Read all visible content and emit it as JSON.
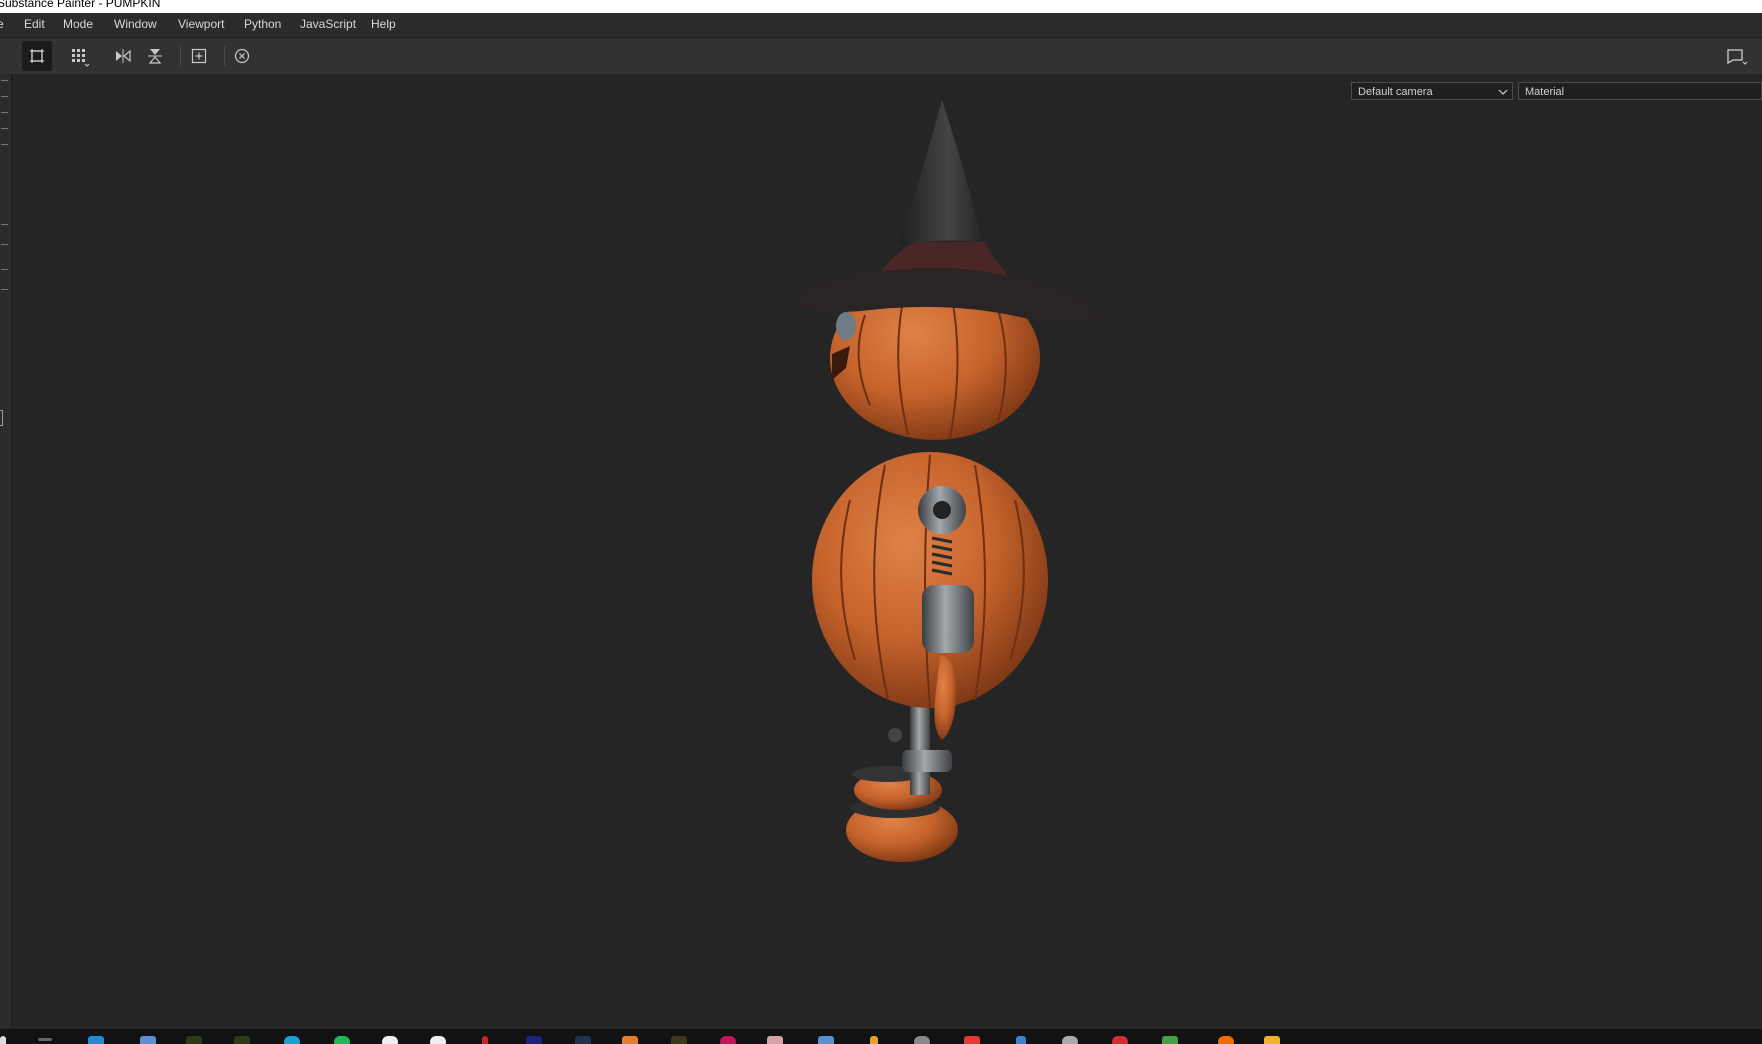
{
  "window": {
    "title": "Substance Painter - PUMPKIN"
  },
  "menubar": {
    "items": [
      {
        "id": "file",
        "label": "e"
      },
      {
        "id": "edit",
        "label": "Edit"
      },
      {
        "id": "mode",
        "label": "Mode"
      },
      {
        "id": "window",
        "label": "Window"
      },
      {
        "id": "viewport",
        "label": "Viewport"
      },
      {
        "id": "python",
        "label": "Python"
      },
      {
        "id": "javascript",
        "label": "JavaScript"
      },
      {
        "id": "help",
        "label": "Help"
      }
    ]
  },
  "toolbar": {
    "buttons": [
      {
        "icon": "texture-set-view-icon",
        "active": true
      },
      {
        "icon": "grid-view-icon",
        "active": false
      },
      {
        "icon": "mirror-horizontal-icon",
        "active": false
      },
      {
        "icon": "mirror-vertical-icon",
        "active": false
      },
      {
        "icon": "frame-selection-icon",
        "active": false
      },
      {
        "icon": "reset-camera-icon",
        "active": false
      }
    ],
    "right_icon": "display-settings-icon"
  },
  "viewport": {
    "camera_select": {
      "value": "Default camera"
    },
    "mode_select": {
      "value": "Material"
    },
    "model": {
      "description_icon": "pumpkin-character-model"
    }
  },
  "colors": {
    "background": "#252525",
    "menubar": "#2b2b2b",
    "toolbar": "#323232",
    "pumpkin": "#c4622b",
    "hat": "#2e2e2e",
    "hat_band": "#4a2626",
    "metal": "#7a7f85"
  },
  "taskbar": {
    "icons": [
      "edge-icon",
      "photos-icon",
      "app-icon-1",
      "app-icon-2",
      "browser-icon",
      "spotify-icon",
      "chrome-icon",
      "chrome-icon-2",
      "app-icon-3",
      "app-icon-4",
      "app-icon-5",
      "blender-icon",
      "app-icon-6",
      "app-icon-7",
      "app-icon-8",
      "app-icon-9",
      "app-icon-10",
      "app-icon-11",
      "app-icon-12",
      "app-icon-13",
      "app-icon-14",
      "app-icon-15",
      "app-icon-16",
      "app-icon-17",
      "folder-icon"
    ]
  }
}
